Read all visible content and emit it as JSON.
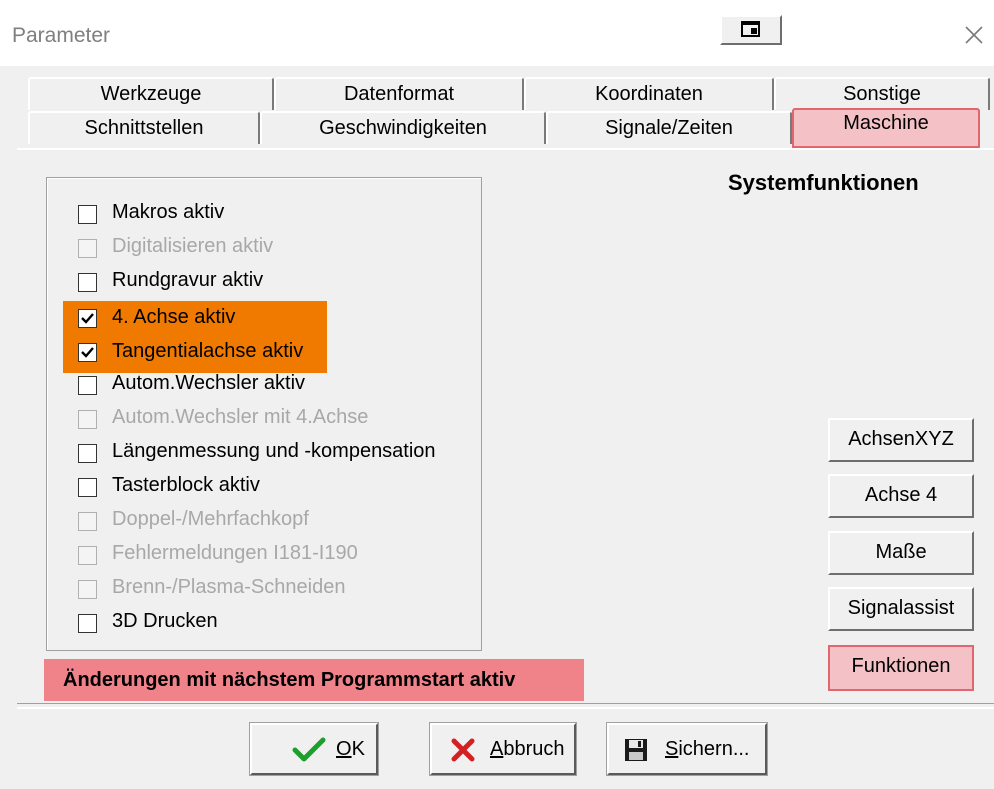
{
  "window": {
    "title": "Parameter"
  },
  "tabs_row1": [
    {
      "label": "Werkzeuge"
    },
    {
      "label": "Datenformat"
    },
    {
      "label": "Koordinaten"
    },
    {
      "label": "Sonstige"
    }
  ],
  "tabs_row2": [
    {
      "label": "Schnittstellen"
    },
    {
      "label": "Geschwindigkeiten"
    },
    {
      "label": "Signale/Zeiten"
    },
    {
      "label": "Maschine",
      "active": true
    }
  ],
  "panel": {
    "heading": "Systemfunktionen",
    "checkboxes": [
      {
        "label": "Makros aktiv",
        "checked": false,
        "enabled": true,
        "highlighted": false
      },
      {
        "label": "Digitalisieren aktiv",
        "checked": false,
        "enabled": false,
        "highlighted": false
      },
      {
        "label": "Rundgravur aktiv",
        "checked": false,
        "enabled": true,
        "highlighted": false
      },
      {
        "label": "4. Achse aktiv",
        "checked": true,
        "enabled": true,
        "highlighted": true
      },
      {
        "label": "Tangentialachse aktiv",
        "checked": true,
        "enabled": true,
        "highlighted": true
      },
      {
        "label": "Autom.Wechsler aktiv",
        "checked": false,
        "enabled": true,
        "highlighted": false
      },
      {
        "label": "Autom.Wechsler mit 4.Achse",
        "checked": false,
        "enabled": false,
        "highlighted": false
      },
      {
        "label": "Längenmessung und -kompensation",
        "checked": false,
        "enabled": true,
        "highlighted": false
      },
      {
        "label": "Tasterblock aktiv",
        "checked": false,
        "enabled": true,
        "highlighted": false
      },
      {
        "label": "Doppel-/Mehrfachkopf",
        "checked": false,
        "enabled": false,
        "highlighted": false
      },
      {
        "label": "Fehlermeldungen I181-I190",
        "checked": false,
        "enabled": false,
        "highlighted": false
      },
      {
        "label": "Brenn-/Plasma-Schneiden",
        "checked": false,
        "enabled": false,
        "highlighted": false
      },
      {
        "label": "3D Drucken",
        "checked": false,
        "enabled": true,
        "highlighted": false
      }
    ],
    "side_buttons": [
      {
        "label": "AchsenXYZ"
      },
      {
        "label": "Achse 4"
      },
      {
        "label": "Maße"
      },
      {
        "label": "Signalassist"
      },
      {
        "label": "Funktionen",
        "active": true
      }
    ],
    "notice": "Änderungen mit nächstem Programmstart aktiv"
  },
  "footer": {
    "ok": {
      "mnemonic": "O",
      "rest": "K",
      "icon": "check-icon"
    },
    "cancel": {
      "mnemonic": "A",
      "rest": "bbruch",
      "icon": "x-icon"
    },
    "save": {
      "mnemonic": "S",
      "rest": "ichern...",
      "icon": "floppy-disk-icon"
    }
  },
  "colors": {
    "highlight_orange": "#f07a00",
    "active_pink": "#f4c2c6",
    "active_border": "#e06670",
    "notice_bg": "#f08289",
    "check_green": "#1e9e2a",
    "cancel_red": "#d42020"
  }
}
